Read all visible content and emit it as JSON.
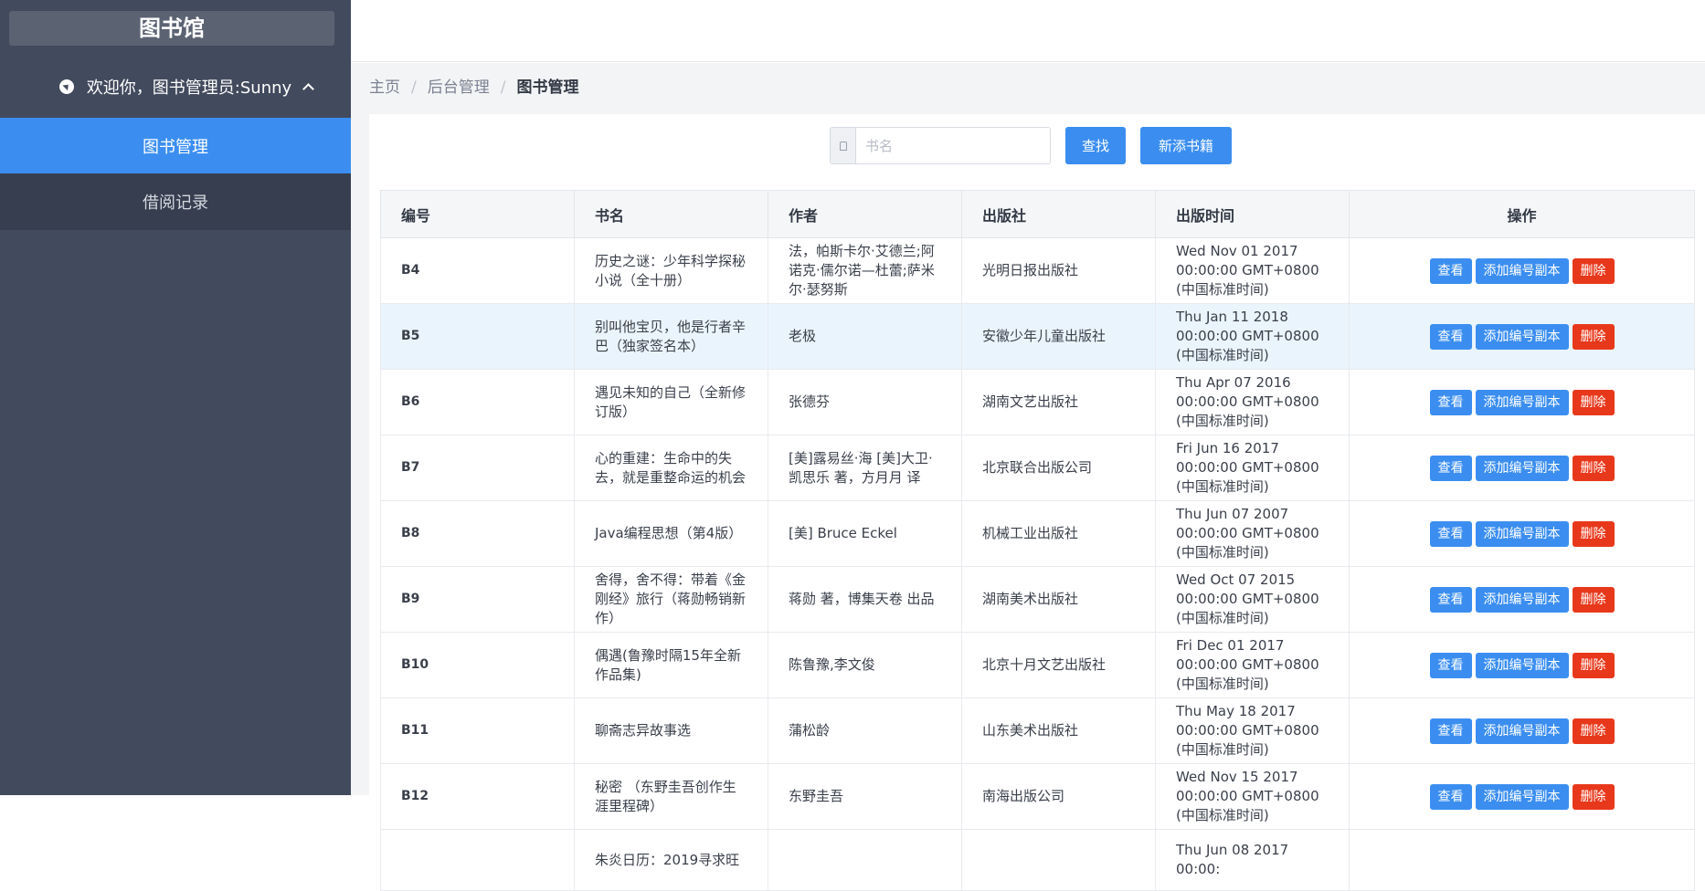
{
  "sidebar": {
    "logo": "图书馆",
    "welcome": "欢迎你，图书管理员:Sunny",
    "menu": [
      {
        "label": "图书管理"
      },
      {
        "label": "借阅记录"
      }
    ]
  },
  "breadcrumb": {
    "home": "主页",
    "admin": "后台管理",
    "current": "图书管理"
  },
  "search": {
    "placeholder": "书名",
    "search_label": "查找",
    "add_label": "新添书籍"
  },
  "table": {
    "headers": {
      "id": "编号",
      "title": "书名",
      "author": "作者",
      "publisher": "出版社",
      "date": "出版时间",
      "ops": "操作"
    },
    "actions": {
      "view": "查看",
      "copy": "添加编号副本",
      "del": "删除"
    },
    "rows": [
      {
        "id": "B4",
        "title": "历史之谜：少年科学探秘小说（全十册）",
        "author": "法，帕斯卡尔·艾德兰;阿诺克·儒尔诺—杜蕾;萨米尔·瑟努斯",
        "publisher": "光明日报出版社",
        "date": "Wed Nov 01 2017 00:00:00 GMT+0800 (中国标准时间)"
      },
      {
        "id": "B5",
        "title": "别叫他宝贝，他是行者辛巴（独家签名本）",
        "author": "老极",
        "publisher": "安徽少年儿童出版社",
        "date": "Thu Jan 11 2018 00:00:00 GMT+0800 (中国标准时间)"
      },
      {
        "id": "B6",
        "title": "遇见未知的自己（全新修订版）",
        "author": "张德芬",
        "publisher": "湖南文艺出版社",
        "date": "Thu Apr 07 2016 00:00:00 GMT+0800 (中国标准时间)"
      },
      {
        "id": "B7",
        "title": "心的重建：生命中的失去，就是重整命运的机会",
        "author": "[美]露易丝·海 [美]大卫·凯思乐 著，方月月 译",
        "publisher": "北京联合出版公司",
        "date": "Fri Jun 16 2017 00:00:00 GMT+0800 (中国标准时间)"
      },
      {
        "id": "B8",
        "title": "Java编程思想（第4版）",
        "author": "[美] Bruce Eckel",
        "publisher": "机械工业出版社",
        "date": "Thu Jun 07 2007 00:00:00 GMT+0800 (中国标准时间)"
      },
      {
        "id": "B9",
        "title": "舍得，舍不得：带着《金刚经》旅行（蒋勋畅销新作）",
        "author": "蒋勋 著，博集天卷 出品",
        "publisher": "湖南美术出版社",
        "date": "Wed Oct 07 2015 00:00:00 GMT+0800 (中国标准时间)"
      },
      {
        "id": "B10",
        "title": "偶遇(鲁豫时隔15年全新作品集)",
        "author": "陈鲁豫,李文俊",
        "publisher": "北京十月文艺出版社",
        "date": "Fri Dec 01 2017 00:00:00 GMT+0800 (中国标准时间)"
      },
      {
        "id": "B11",
        "title": "聊斋志异故事选",
        "author": "蒲松龄",
        "publisher": "山东美术出版社",
        "date": "Thu May 18 2017 00:00:00 GMT+0800 (中国标准时间)"
      },
      {
        "id": "B12",
        "title": "秘密 （东野圭吾创作生涯里程碑）",
        "author": "东野圭吾",
        "publisher": "南海出版公司",
        "date": "Wed Nov 15 2017 00:00:00 GMT+0800 (中国标准时间)"
      },
      {
        "id": "",
        "title": "朱炎日历：2019寻求旺",
        "author": "",
        "publisher": "",
        "date": "Thu Jun 08 2017 00:00:"
      }
    ]
  },
  "colors": {
    "sidebar": "#424a5d",
    "active": "#3b8ef0",
    "danger": "#e8381b",
    "highlight_row": "#eaf4fd"
  }
}
